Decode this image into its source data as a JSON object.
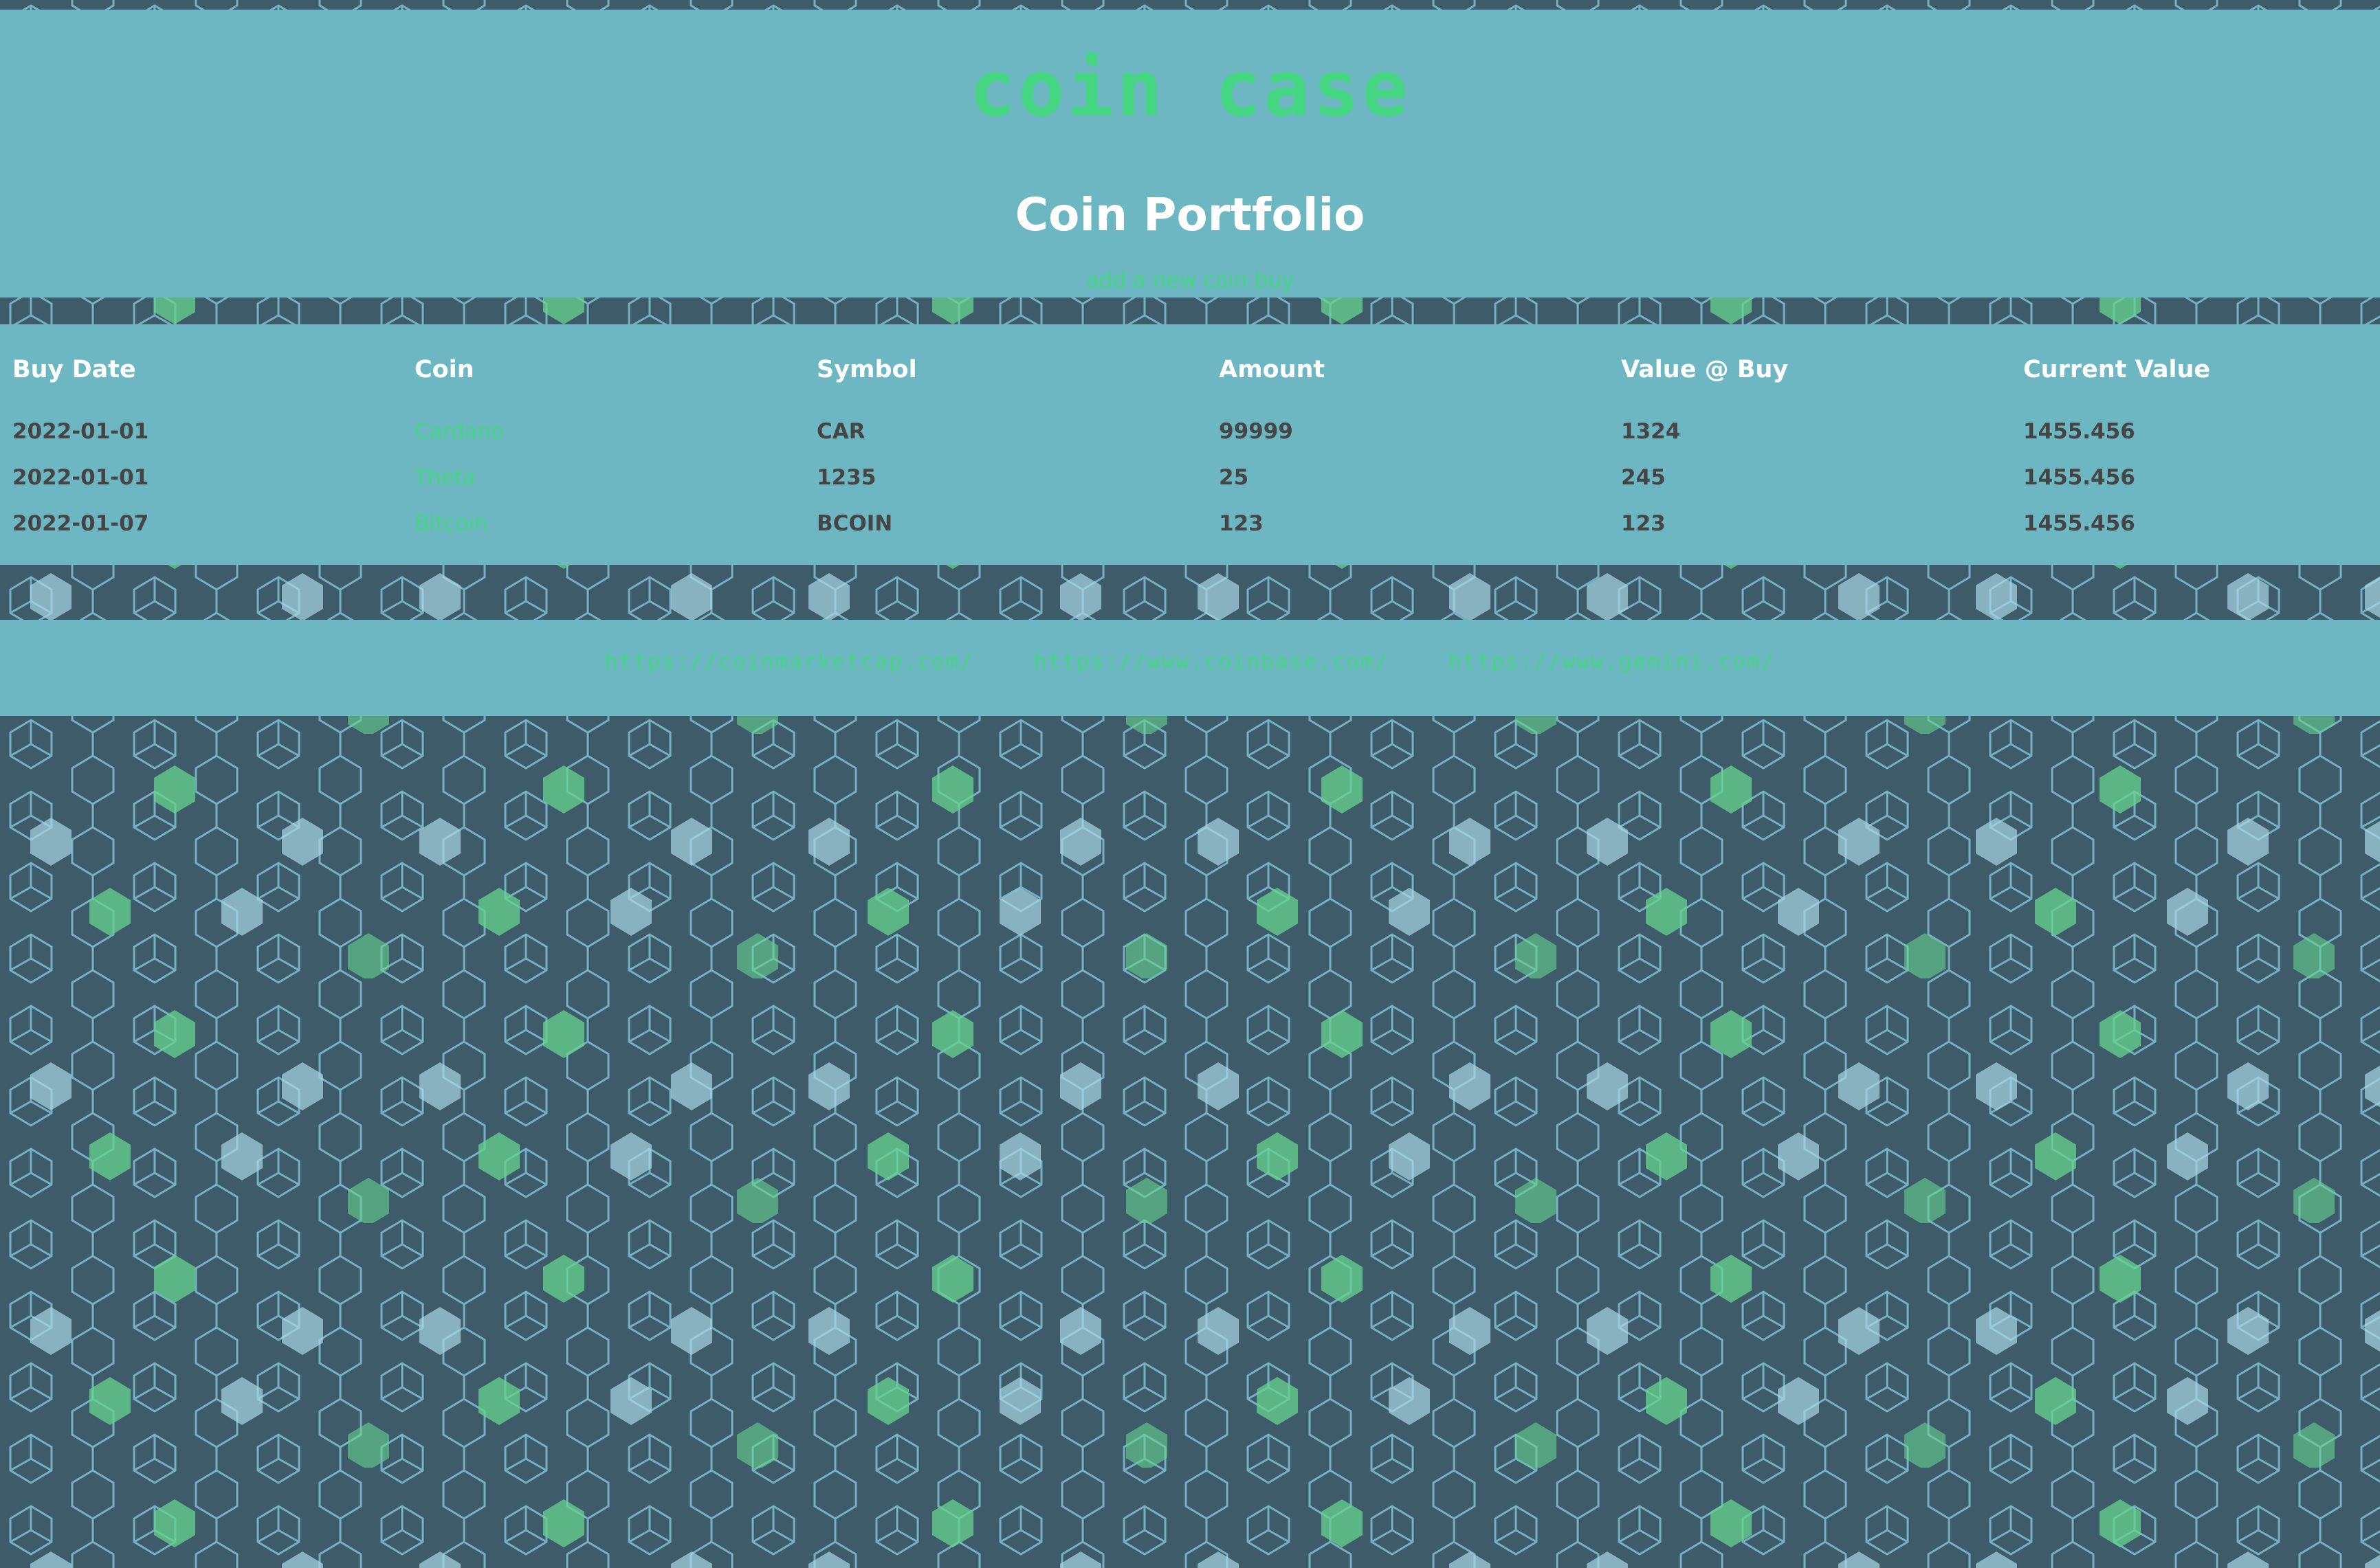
{
  "colors": {
    "background": "#3d5b68",
    "panel": "#6db7c3",
    "accent_green": "#45d681",
    "hex_light": "#a9d8e6",
    "hex_green": "#66d38f",
    "heading_text": "#ffffff",
    "body_text": "#454545"
  },
  "header": {
    "site_title": "coin case",
    "page_heading": "Coin Portfolio",
    "add_link": "add a new coin buy"
  },
  "table": {
    "columns": [
      "Buy Date",
      "Coin",
      "Symbol",
      "Amount",
      "Value @ Buy",
      "Current Value"
    ],
    "rows": [
      {
        "buy_date": "2022-01-01",
        "coin": "Cardano",
        "symbol": "CAR",
        "amount": "99999",
        "value_at_buy": "1324",
        "current_value": "1455.456"
      },
      {
        "buy_date": "2022-01-01",
        "coin": "Theta",
        "symbol": "1235",
        "amount": "25",
        "value_at_buy": "245",
        "current_value": "1455.456"
      },
      {
        "buy_date": "2022-01-07",
        "coin": "Bitcoin",
        "symbol": "BCOIN",
        "amount": "123",
        "value_at_buy": "123",
        "current_value": "1455.456"
      }
    ]
  },
  "footer": {
    "links": [
      "https://coinmarketcap.com/",
      "https://www.coinbase.com/",
      "https://www.gemini.com/"
    ]
  }
}
